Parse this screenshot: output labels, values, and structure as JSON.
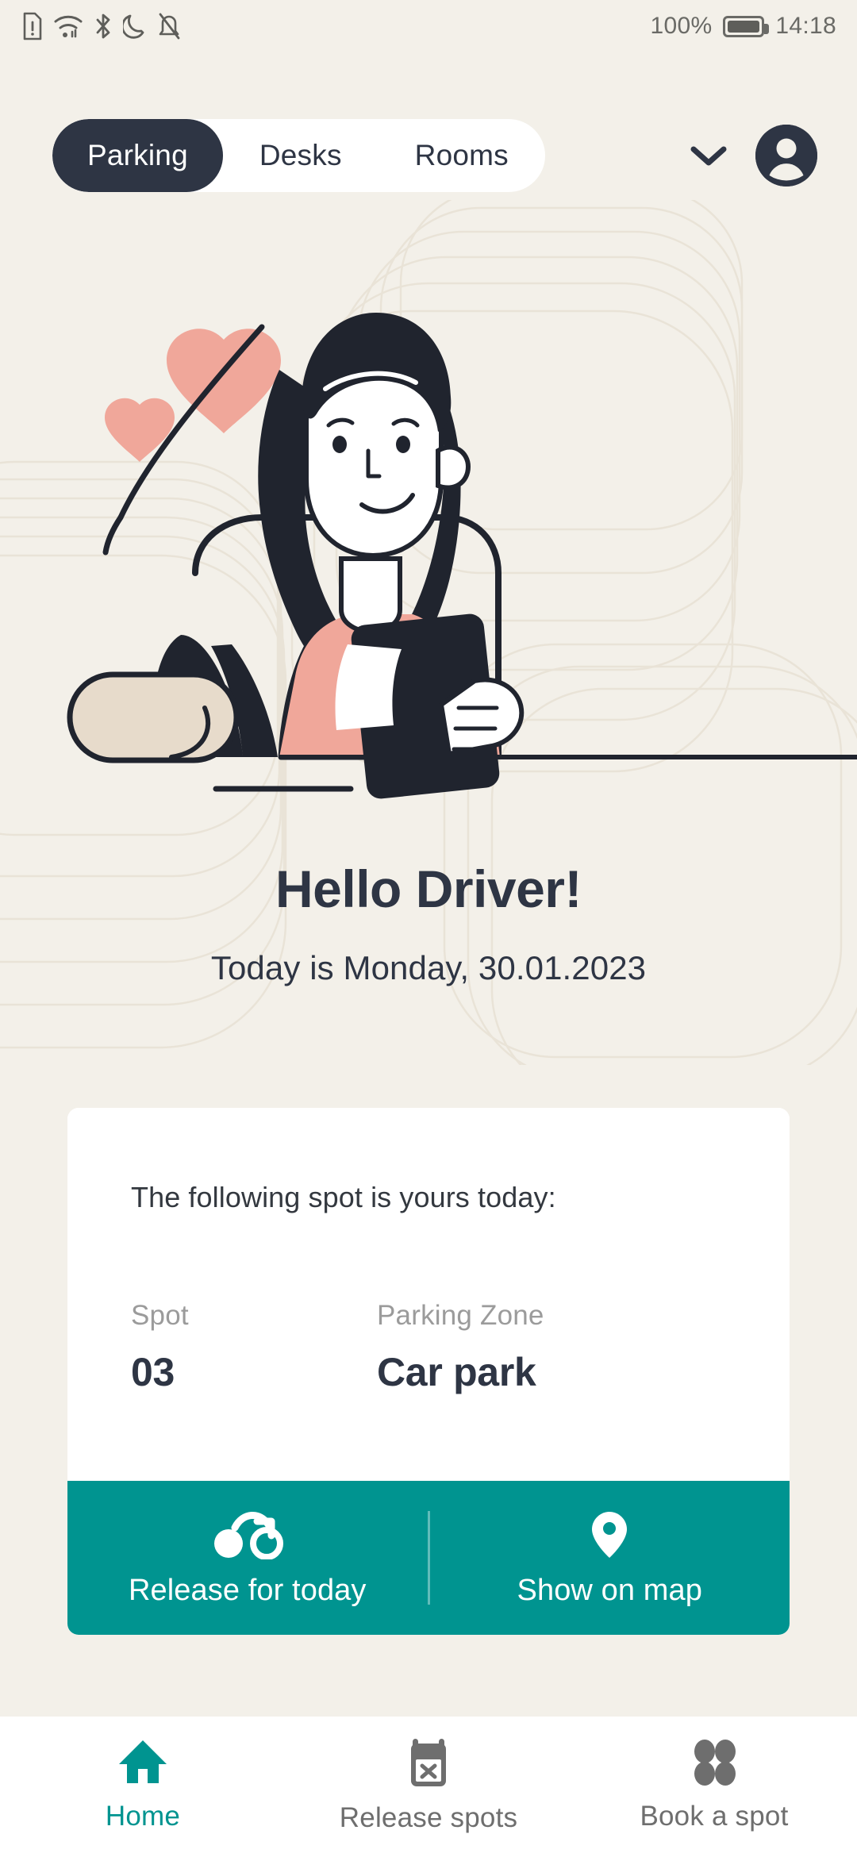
{
  "statusbar": {
    "icons": [
      "sim-alert-icon",
      "wifi-icon",
      "bluetooth-icon",
      "do-not-disturb-moon-icon",
      "notifications-off-icon"
    ],
    "battery_percent": "100%",
    "battery_icon": "battery-full-icon",
    "time": "14:18"
  },
  "topbar": {
    "tabs": [
      {
        "label": "Parking",
        "active": true
      },
      {
        "label": "Desks",
        "active": false
      },
      {
        "label": "Rooms",
        "active": false
      }
    ],
    "chevron_icon": "chevron-down-icon",
    "avatar_icon": "account-avatar-icon"
  },
  "hero": {
    "illustration": "woman-in-car-with-phone-illustration",
    "greeting": "Hello Driver!",
    "subgreeting": "Today is Monday, 30.01.2023"
  },
  "card": {
    "lead": "The following spot is yours today:",
    "fields": [
      {
        "label": "Spot",
        "value": "03"
      },
      {
        "label": "Parking Zone",
        "value": "Car park"
      }
    ],
    "actions": [
      {
        "label": "Release for today",
        "icon": "transfer-release-icon"
      },
      {
        "label": "Show on map",
        "icon": "map-pin-icon"
      }
    ]
  },
  "bottomnav": {
    "items": [
      {
        "label": "Home",
        "icon": "home-icon",
        "active": true
      },
      {
        "label": "Release spots",
        "icon": "calendar-x-icon",
        "active": false
      },
      {
        "label": "Book a spot",
        "icon": "grid-dots-icon",
        "active": false
      }
    ]
  },
  "colors": {
    "background": "#F3F0E9",
    "navy": "#2E3544",
    "teal": "#009490",
    "card": "#FFFFFF",
    "muted": "#9B9B9B",
    "pink": "#F0A79A",
    "skin": "#FFFFFF",
    "beige": "#E7DBCB"
  }
}
